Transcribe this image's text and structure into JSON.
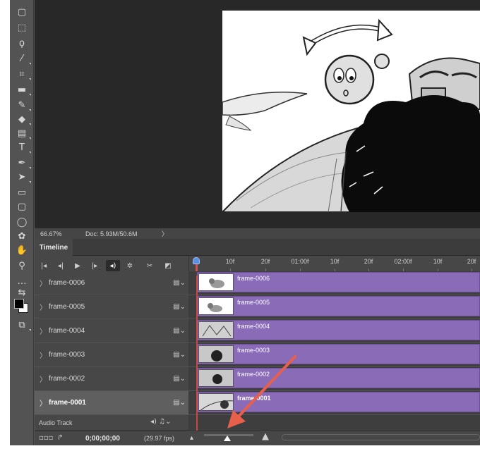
{
  "statusbar": {
    "zoom": "66.67%",
    "doc": "Doc: 5.93M/50.6M",
    "arrow": "〉"
  },
  "timeline": {
    "tab_label": "Timeline",
    "ruler_labels": [
      "10f",
      "20f",
      "01:00f",
      "10f",
      "20f",
      "02:00f",
      "10f",
      "20f"
    ],
    "layers": [
      {
        "name": "frame-0006",
        "clip": "frame-0006"
      },
      {
        "name": "frame-0005",
        "clip": "frame-0005"
      },
      {
        "name": "frame-0004",
        "clip": "frame-0004"
      },
      {
        "name": "frame-0003",
        "clip": "frame-0003"
      },
      {
        "name": "frame-0002",
        "clip": "frame-0002"
      },
      {
        "name": "frame-0001",
        "clip": "frame-0001",
        "selected": true
      }
    ],
    "audio_track_label": "Audio Track",
    "timecode": "0;00;00;00",
    "fps": "(29.97 fps)"
  },
  "colors": {
    "clip": "#8a6bb8",
    "playhead": "#c84848",
    "annotation_arrow": "#e8604c"
  },
  "icons": {
    "toolbar": [
      "new-doc-icon",
      "marquee-icon",
      "lasso-icon",
      "magic-wand-icon",
      "crop-icon",
      "ruler-icon",
      "brush-icon",
      "eraser-icon",
      "gradient-icon",
      "type-icon",
      "pen-icon",
      "path-select-icon",
      "rectangle-icon",
      "rounded-rect-icon",
      "ellipse-icon",
      "custom-shape-icon",
      "hand-icon",
      "zoom-icon",
      "more-tools-icon",
      "swap-colors-icon",
      "color-swatch-icon",
      "screen-mode-icon"
    ]
  }
}
